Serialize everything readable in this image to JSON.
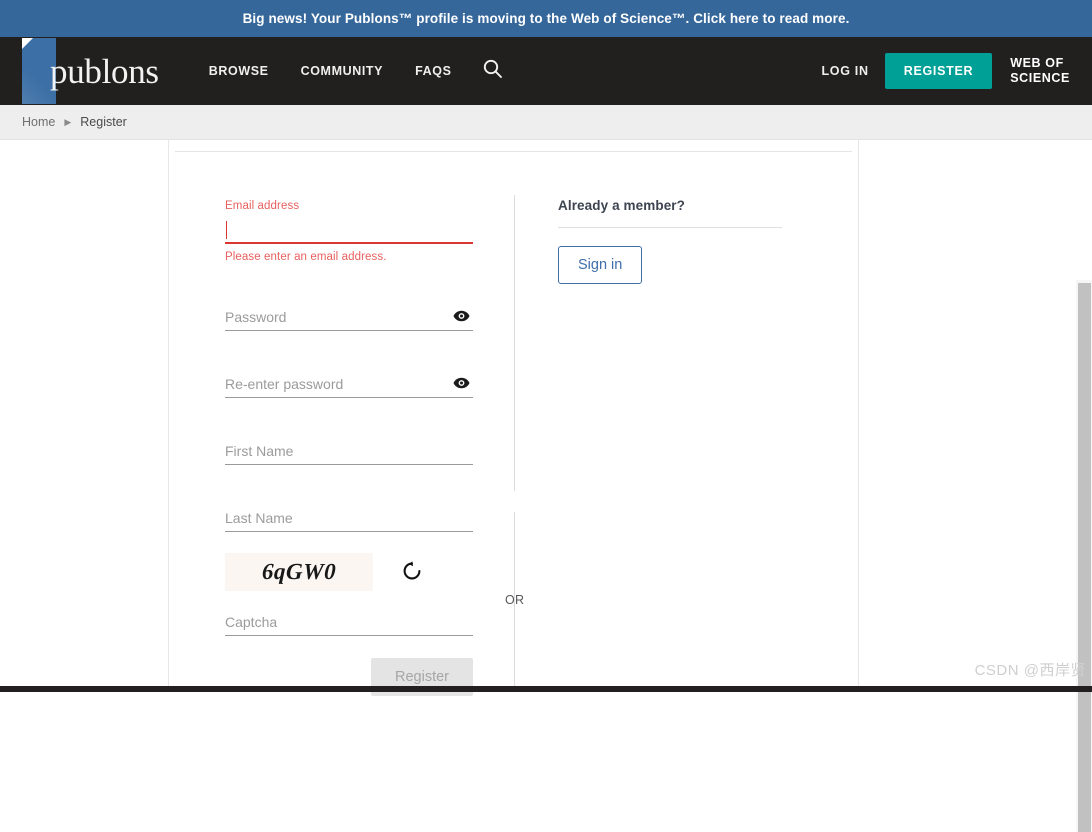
{
  "announcement": {
    "text": "Big news! Your Publons™ profile is moving to the Web of Science™. Click here to read more.",
    "background_color": "#35679b"
  },
  "navbar": {
    "logo_text": "publons",
    "logo_mark_color": "#3c6fa5",
    "background_color": "#221f1f",
    "links": [
      {
        "label": "BROWSE",
        "name": "nav-link-browse"
      },
      {
        "label": "COMMUNITY",
        "name": "nav-link-community"
      },
      {
        "label": "FAQS",
        "name": "nav-link-faqs"
      }
    ],
    "search_icon": "search-icon",
    "login_label": "LOG IN",
    "register_label": "REGISTER",
    "register_color": "#00a096",
    "web_of_science_line1": "WEB OF",
    "web_of_science_line2": "SCIENCE"
  },
  "breadcrumb": {
    "items": [
      {
        "label": "Home",
        "current": false
      },
      {
        "label": "Register",
        "current": true
      }
    ],
    "separator": "▶"
  },
  "register_form": {
    "email": {
      "label": "Email address",
      "value": "",
      "placeholder": "",
      "error": "Please enter an email address.",
      "error_color": "#d9372f",
      "has_error": true
    },
    "password": {
      "placeholder": "Password",
      "value": "",
      "toggle_icon": "eye-icon"
    },
    "password_confirm": {
      "placeholder": "Re-enter password",
      "value": "",
      "toggle_icon": "eye-icon"
    },
    "first_name": {
      "placeholder": "First Name",
      "value": ""
    },
    "last_name": {
      "placeholder": "Last Name",
      "value": ""
    },
    "captcha": {
      "image_text": "6qGW0",
      "image_background": "#fbf6f2",
      "refresh_icon": "refresh-icon",
      "input_placeholder": "Captcha",
      "input_value": ""
    },
    "submit_label": "Register",
    "submit_disabled": true
  },
  "divider": {
    "or_label": "OR"
  },
  "member_panel": {
    "title": "Already a member?",
    "signin_label": "Sign in",
    "signin_color": "#3d6fa8"
  },
  "scrollbar": {
    "thumb_color": "#c1c1c1",
    "track_color": "#f6f6f6"
  },
  "watermark": {
    "text": "CSDN @西岸贤"
  }
}
